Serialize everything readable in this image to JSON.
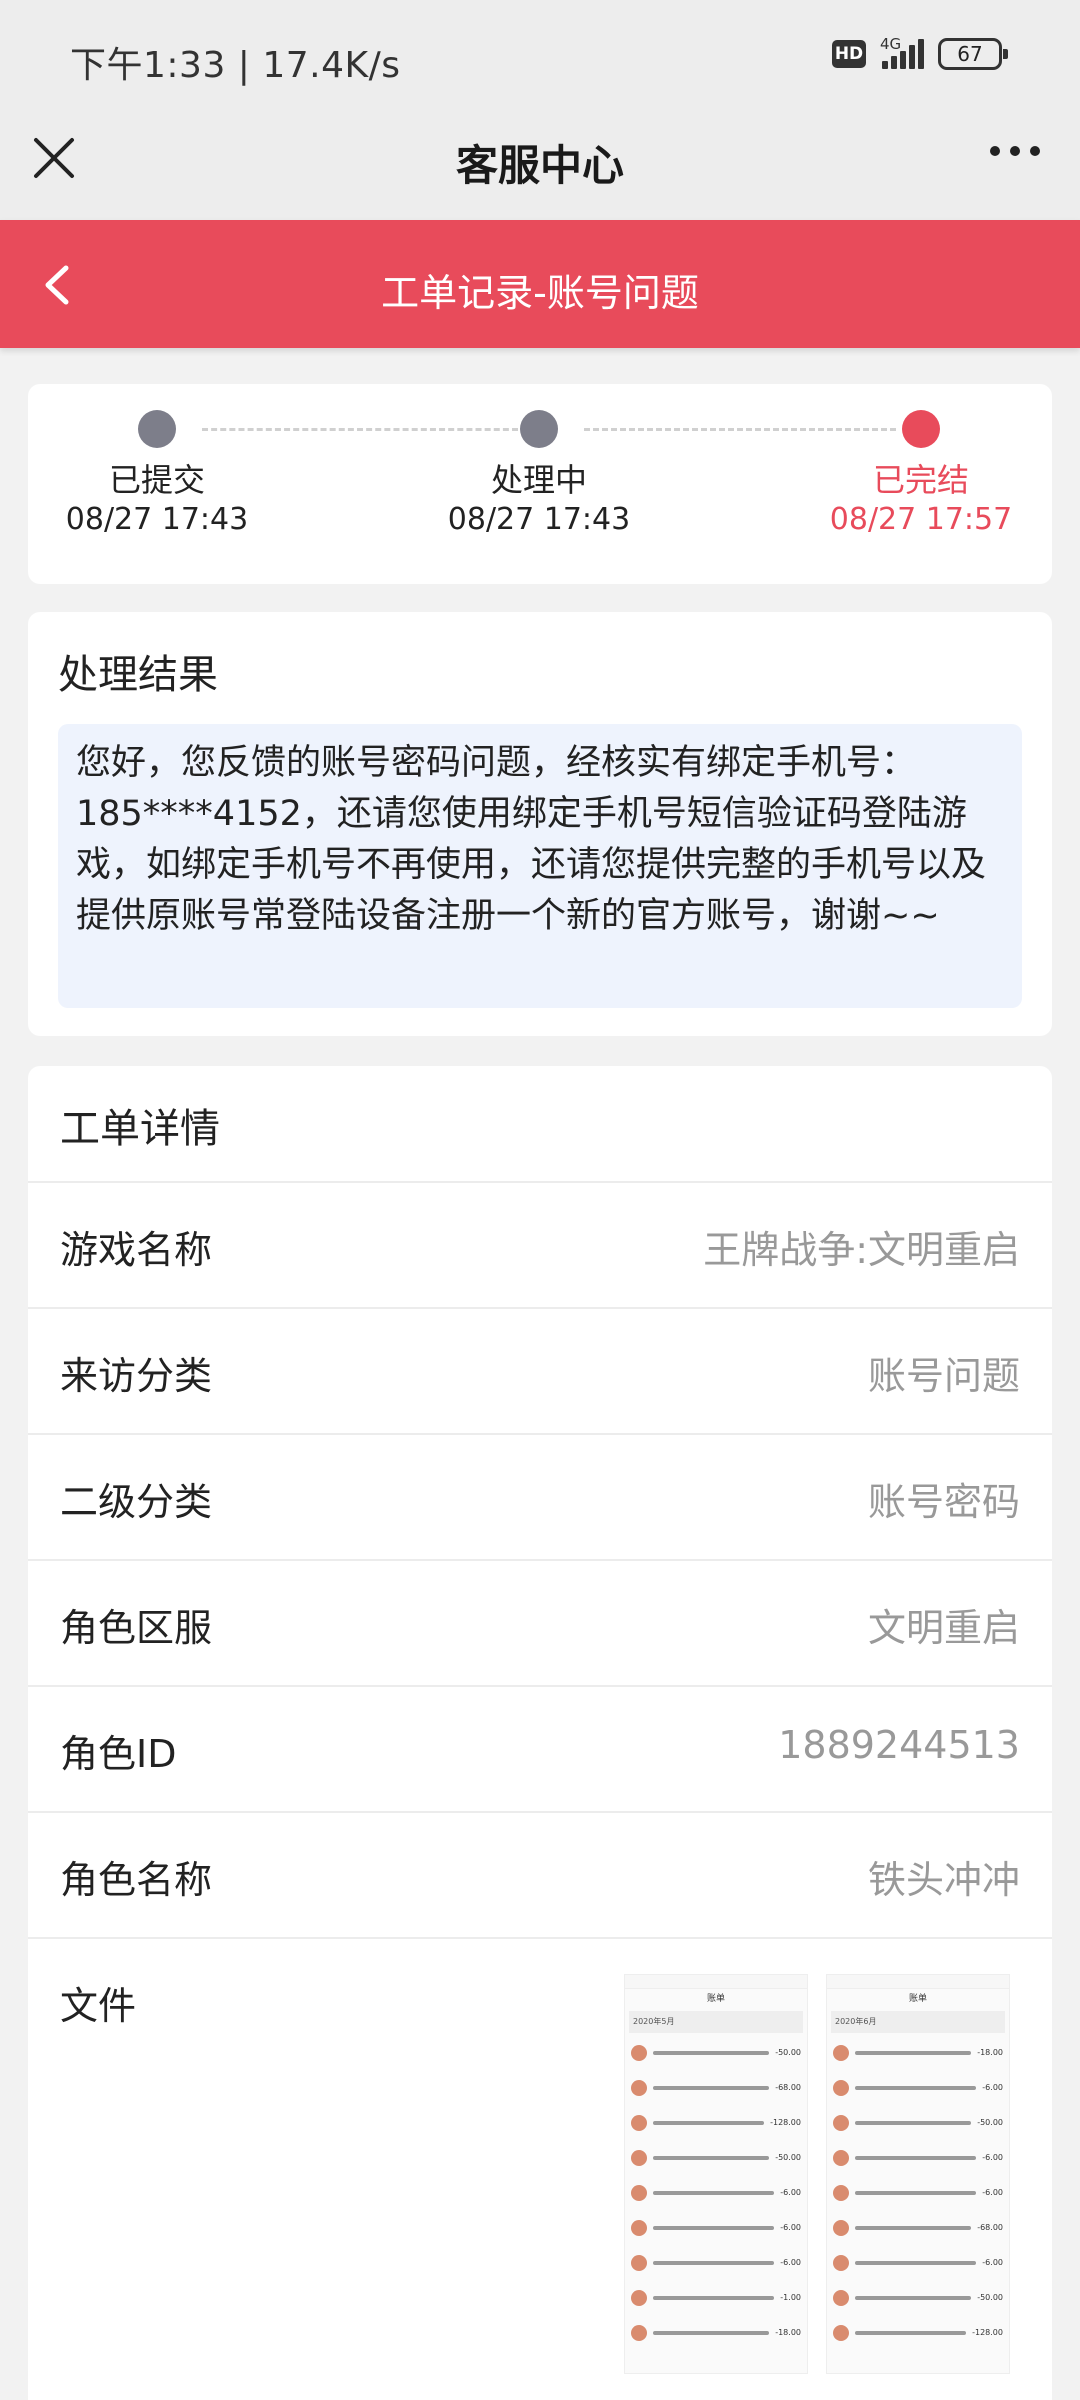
{
  "status_bar": {
    "time": "下午1:33 | 17.4K/s",
    "hd": "HD",
    "network": "4G",
    "battery": "67"
  },
  "app_bar": {
    "title": "客服中心"
  },
  "header": {
    "title": "工单记录-账号问题",
    "accent_color": "#e84b5b"
  },
  "progress": {
    "steps": [
      {
        "label": "已提交",
        "date": "08/27 17:43",
        "state": "past"
      },
      {
        "label": "处理中",
        "date": "08/27 17:43",
        "state": "past"
      },
      {
        "label": "已完结",
        "date": "08/27 17:57",
        "state": "current"
      }
    ]
  },
  "result": {
    "heading": "处理结果",
    "text": "您好，您反馈的账号密码问题，经核实有绑定手机号：185****4152，还请您使用绑定手机号短信验证码登陆游戏，如绑定手机号不再使用，还请您提供完整的手机号以及提供原账号常登陆设备注册一个新的官方账号，谢谢~~"
  },
  "details": {
    "heading": "工单详情",
    "rows": [
      {
        "key": "游戏名称",
        "value": "王牌战争:文明重启"
      },
      {
        "key": "来访分类",
        "value": "账号问题"
      },
      {
        "key": "二级分类",
        "value": "账号密码"
      },
      {
        "key": "角色区服",
        "value": "文明重启"
      },
      {
        "key": "角色ID",
        "value": "1889244513"
      },
      {
        "key": "角色名称",
        "value": "铁头冲冲"
      }
    ],
    "file_label": "文件",
    "attachments": [
      {
        "title": "账单",
        "month": "2020年5月",
        "amounts": [
          "-50.00",
          "-68.00",
          "-128.00",
          "-50.00",
          "-6.00",
          "-6.00",
          "-6.00",
          "-1.00",
          "-18.00"
        ]
      },
      {
        "title": "账单",
        "month": "2020年6月",
        "amounts": [
          "-18.00",
          "-6.00",
          "-50.00",
          "-6.00",
          "-6.00",
          "-68.00",
          "-6.00",
          "-50.00",
          "-128.00"
        ]
      }
    ]
  }
}
